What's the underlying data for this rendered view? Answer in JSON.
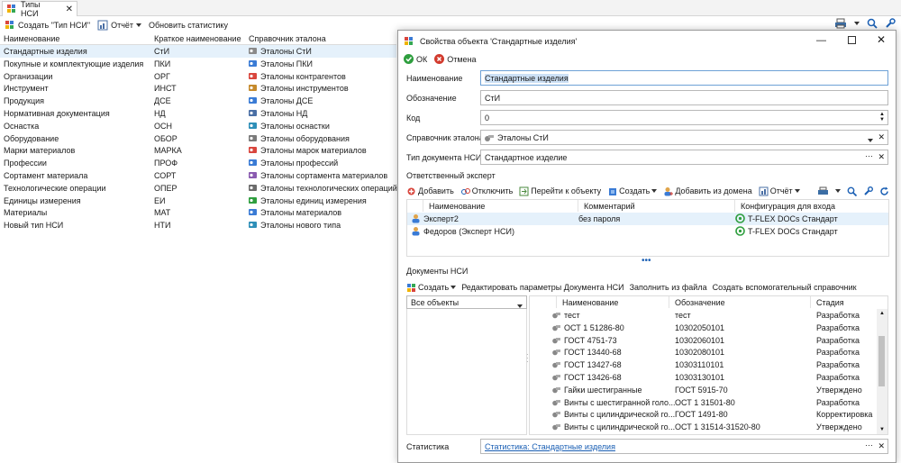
{
  "tab": {
    "title": "Типы НСИ"
  },
  "toolbar": {
    "create": "Создать \"Тип НСИ\"",
    "report": "Отчёт",
    "refresh": "Обновить статистику"
  },
  "columns": {
    "name": "Наименование",
    "short": "Краткое наименование",
    "ref": "Справочник эталона"
  },
  "rows": [
    {
      "name": "Стандартные изделия",
      "short": "СтИ",
      "ref": "Эталоны СтИ"
    },
    {
      "name": "Покупные и комплектующие изделия",
      "short": "ПКИ",
      "ref": "Эталоны ПКИ"
    },
    {
      "name": "Организации",
      "short": "ОРГ",
      "ref": "Эталоны контрагентов"
    },
    {
      "name": "Инструмент",
      "short": "ИНСТ",
      "ref": "Эталоны инструментов"
    },
    {
      "name": "Продукция",
      "short": "ДСЕ",
      "ref": "Эталоны ДСЕ"
    },
    {
      "name": "Нормативная документация",
      "short": "НД",
      "ref": "Эталоны НД"
    },
    {
      "name": "Оснастка",
      "short": "ОСН",
      "ref": "Эталоны оснастки"
    },
    {
      "name": "Оборудование",
      "short": "ОБОР",
      "ref": "Эталоны оборудования"
    },
    {
      "name": "Марки материалов",
      "short": "МАРКА",
      "ref": "Эталоны марок материалов"
    },
    {
      "name": "Профессии",
      "short": "ПРОФ",
      "ref": "Эталоны профессий"
    },
    {
      "name": "Сортамент материала",
      "short": "СОРТ",
      "ref": "Эталоны сортамента материалов"
    },
    {
      "name": "Технологические операции",
      "short": "ОПЕР",
      "ref": "Эталоны технологических операций"
    },
    {
      "name": "Единицы измерения",
      "short": "ЕИ",
      "ref": "Эталоны единиц измерения"
    },
    {
      "name": "Материалы",
      "short": "МАТ",
      "ref": "Эталоны материалов"
    },
    {
      "name": "Новый тип НСИ",
      "short": "НТИ",
      "ref": "Эталоны нового типа"
    }
  ],
  "dialog": {
    "title": "Свойства объекта 'Стандартные изделия'",
    "ok": "ОК",
    "cancel": "Отмена",
    "fields": {
      "name_label": "Наименование",
      "name_value": "Стандартные изделия",
      "designation_label": "Обозначение",
      "designation_value": "СтИ",
      "code_label": "Код",
      "code_value": "0",
      "ref_label": "Справочник эталона",
      "ref_value": "Эталоны СтИ",
      "doctype_label": "Тип документа НСИ",
      "doctype_value": "Стандартное изделие"
    },
    "expert": {
      "section": "Ответственный эксперт",
      "toolbar": {
        "add": "Добавить",
        "detach": "Отключить",
        "goto": "Перейти к объекту",
        "create": "Создать",
        "add_domain": "Добавить из домена",
        "report": "Отчёт"
      },
      "columns": {
        "name": "Наименование",
        "comment": "Комментарий",
        "config": "Конфигурация для входа"
      },
      "rows": [
        {
          "name": "Эксперт2",
          "comment": "без пароля",
          "config": "T-FLEX DOCs Стандарт"
        },
        {
          "name": "Федоров (Эксперт НСИ)",
          "comment": "",
          "config": "T-FLEX DOCs Стандарт"
        }
      ]
    },
    "docs": {
      "section": "Документы НСИ",
      "toolbar": {
        "create": "Создать",
        "edit": "Редактировать параметры Документа НСИ",
        "fill": "Заполнить из файла",
        "aux": "Создать вспомогательный справочник"
      },
      "filter": "Все объекты",
      "columns": {
        "name": "Наименование",
        "designation": "Обозначение",
        "stage": "Стадия"
      },
      "rows": [
        {
          "name": "тест",
          "designation": "тест",
          "stage": "Разработка"
        },
        {
          "name": "ОСТ 1 51286-80",
          "designation": "10302050101",
          "stage": "Разработка"
        },
        {
          "name": "ГОСТ 4751-73",
          "designation": "10302060101",
          "stage": "Разработка"
        },
        {
          "name": "ГОСТ 13440-68",
          "designation": "10302080101",
          "stage": "Разработка"
        },
        {
          "name": "ГОСТ 13427-68",
          "designation": "10303110101",
          "stage": "Разработка"
        },
        {
          "name": "ГОСТ 13426-68",
          "designation": "10303130101",
          "stage": "Разработка"
        },
        {
          "name": "Гайки шестигранные",
          "designation": "ГОСТ 5915-70",
          "stage": "Утверждено"
        },
        {
          "name": "Винты с шестигранной голо...",
          "designation": "ОСТ 1 31501-80",
          "stage": "Разработка"
        },
        {
          "name": "Винты с цилиндрической го...",
          "designation": "ГОСТ 1491-80",
          "stage": "Корректировка"
        },
        {
          "name": "Винты с цилиндрической го...",
          "designation": "ОСТ 1 31514-31520-80",
          "stage": "Утверждено"
        }
      ]
    },
    "stats_label": "Статистика",
    "stats_value": "Статистика: Стандартные изделия"
  },
  "colors": {
    "accent": "#1a5fb4",
    "selection": "#e5f1fb",
    "ok_green": "#2e9e3e",
    "cancel_red": "#d23b2e"
  }
}
